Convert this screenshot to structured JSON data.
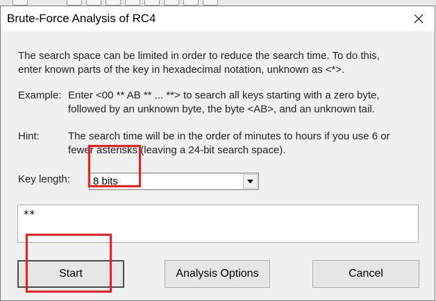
{
  "dialog": {
    "title": "Brute-Force Analysis of RC4",
    "intro_line1": "The search space can be limited in order to reduce the search time. To do this,",
    "intro_line2": "enter known parts of the key in hexadecimal notation, unknown as <*>.",
    "example_label": "Example:",
    "example_line1": "Enter <00 ** AB ** ... **>  to search all keys starting with a zero byte,",
    "example_line2": "followed by an unknown byte, the byte <AB>, and an unknown tail.",
    "hint_label": "Hint:",
    "hint_line1": "The search time will be in the order of minutes to hours if you use 6 or",
    "hint_line2": "fewer asterisks (leaving a 24-bit search space).",
    "key_length_label": "Key length:",
    "key_length_value": "8 bits",
    "key_pattern_value": "**",
    "start_label": "Start",
    "analysis_options_label": "Analysis Options",
    "cancel_label": "Cancel"
  },
  "icons": {
    "close": "close-icon",
    "dropdown": "chevron-down-icon"
  },
  "colors": {
    "annotation_highlight": "#ff1a1a",
    "dialog_background": "#f0f0f0",
    "titlebar_background": "#ffffff"
  }
}
